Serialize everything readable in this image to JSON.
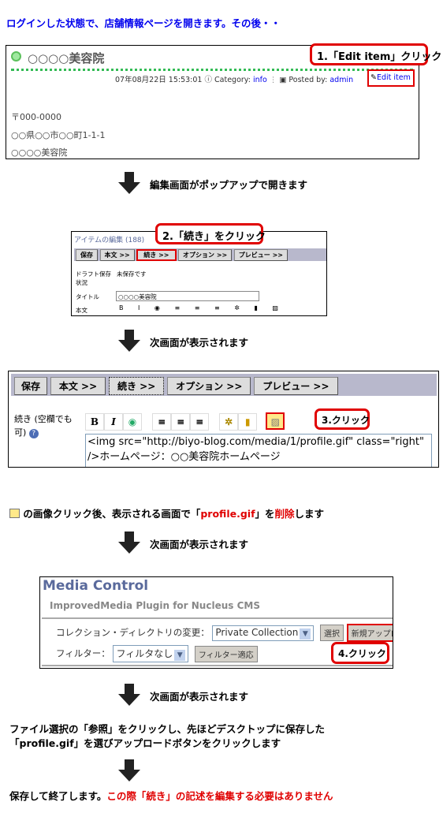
{
  "intro": "ログインした状態で、店舗情報ページを開きます。その後・・",
  "step1": {
    "title": "○○○○美容院",
    "date": "07年08月22日 15:53:01",
    "category_label": "Category:",
    "category_value": "info",
    "posted_label": "Posted by:",
    "posted_value": "admin",
    "edit_item": "Edit item",
    "address": [
      "〒000-0000",
      "○○県○○市○○町1-1-1",
      "○○○○美容院"
    ],
    "callout": "1.「Edit item」クリック"
  },
  "arrow1_text": "編集画面がポップアップで開きます",
  "step2": {
    "title": "アイテムの編集 (188)",
    "tabs": [
      "保存",
      "本文 >>",
      "続き >>",
      "オプション >>",
      "プレビュー >>"
    ],
    "draft_label": "ドラフト保存状況",
    "draft_value": "未保存です",
    "title_label": "タイトル",
    "title_value": "○○○○美容院",
    "body_label": "本文",
    "callout": "2.「続き」をクリック"
  },
  "arrow2_text": "次画面が表示されます",
  "step3": {
    "tabs": [
      "保存",
      "本文 >>",
      "続き >>",
      "オプション >>",
      "プレビュー >>"
    ],
    "label": "続き (空欄でも可)",
    "textarea_value": "<img src=\"http://biyo-blog.com/media/1/profile.gif\" class=\"right\" />ホームページ：○○美容院ホームページ",
    "callout": "3.クリック"
  },
  "instruction": {
    "pre": " の画像クリック後、表示される画面で「",
    "file": "profile.gif",
    "mid": "」を",
    "del": "削除",
    "post": "します"
  },
  "arrow3_text": "次画面が表示されます",
  "step4": {
    "title": "Media Control",
    "subtitle": "ImprovedMedia Plugin for Nucleus CMS",
    "collection_label": "コレクション・ディレクトリの変更：",
    "collection_value": "Private Collection",
    "select_button": "選択",
    "upload_button": "新規アップロード",
    "filter_label": "フィルター：",
    "filter_value": "フィルタなし",
    "filter_button": "フィルター適応",
    "callout": "4.クリック"
  },
  "arrow4_text": "次画面が表示されます",
  "paragraph": [
    "ファイル選択の「参照」をクリックし、先ほどデスクトップに保存した",
    "「profile.gif」を選びアップロードボタンをクリックします"
  ],
  "final": {
    "pre": "保存して終了します。",
    "red": "この際「続き」の記述を編集する必要はありません"
  },
  "colors": {
    "accent_red": "#e00000",
    "link_blue": "#0000ee",
    "media_title": "#5a6a9c"
  }
}
